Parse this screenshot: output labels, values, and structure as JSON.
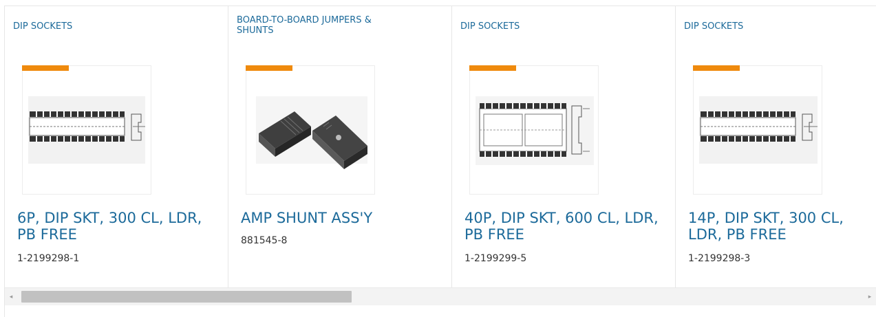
{
  "products": [
    {
      "category": "DIP SOCKETS",
      "title": "6P, DIP SKT, 300 CL, LDR, PB FREE",
      "part_number": "1-2199298-1",
      "image": "dip-socket-drawing"
    },
    {
      "category": "BOARD-TO-BOARD JUMPERS & SHUNTS",
      "title": "AMP SHUNT ASS'Y",
      "part_number": "881545-8",
      "image": "shunt-photo"
    },
    {
      "category": "DIP SOCKETS",
      "title": "40P, DIP SKT, 600 CL, LDR, PB FREE",
      "part_number": "1-2199299-5",
      "image": "dip-socket-wide-drawing"
    },
    {
      "category": "DIP SOCKETS",
      "title": "14P, DIP SKT, 300 CL, LDR, PB FREE",
      "part_number": "1-2199298-3",
      "image": "dip-socket-drawing"
    }
  ],
  "scrollbar": {
    "left_arrow_icon": "◂",
    "right_arrow_icon": "▸"
  },
  "colors": {
    "link": "#1c6a9a",
    "accent_stripe": "#ef8a0d",
    "part_number": "#333333"
  }
}
